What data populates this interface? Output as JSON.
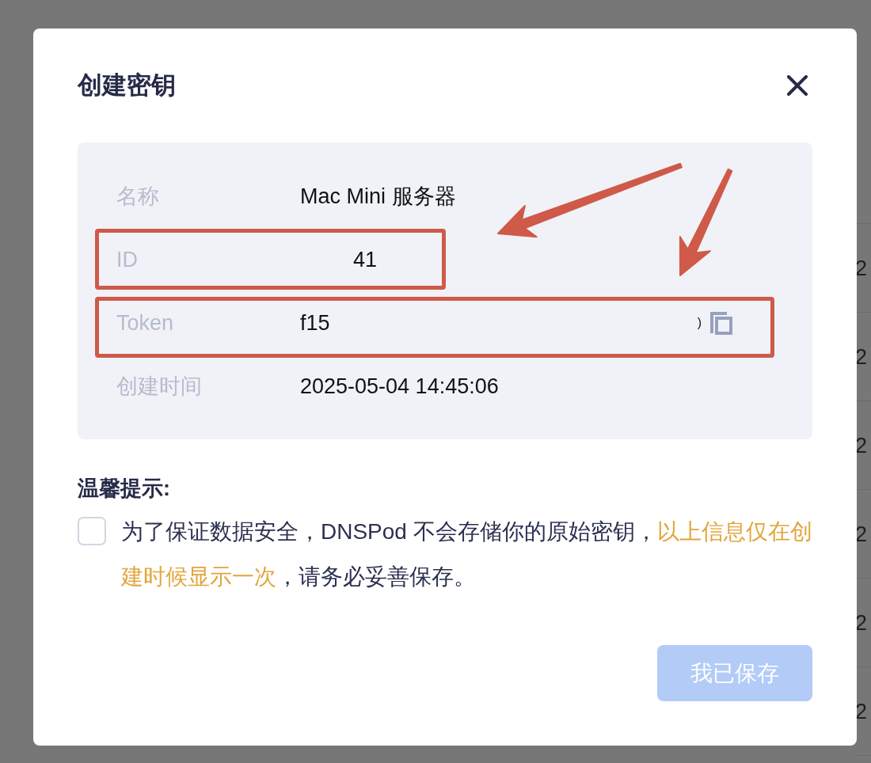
{
  "dialog": {
    "title": "创建密钥"
  },
  "details": [
    {
      "label": "名称",
      "value": "Mac Mini 服务器",
      "kind": "text",
      "highlighted": false
    },
    {
      "label": "ID",
      "value": "41",
      "kind": "masked",
      "highlighted": true
    },
    {
      "label": "Token",
      "value": "f15",
      "tail": ")",
      "kind": "secret",
      "highlighted": true
    },
    {
      "label": "创建时间",
      "value": "2025-05-04 14:45:06",
      "kind": "text",
      "highlighted": false
    }
  ],
  "notice": {
    "heading": "温馨提示:",
    "checked": false,
    "segments": [
      {
        "text": "为了保证数据安全，DNSPod 不会存储你的原始密钥，",
        "emphasis": false
      },
      {
        "text": "以上信息仅在创建时候显示一次",
        "emphasis": true
      },
      {
        "text": "，请务必妥善保存。",
        "emphasis": false
      }
    ]
  },
  "confirm_button": {
    "label": "我已保存",
    "disabled": true
  },
  "background_table": {
    "cells": [
      "2",
      "2",
      "2",
      "2",
      "2",
      "2"
    ]
  }
}
